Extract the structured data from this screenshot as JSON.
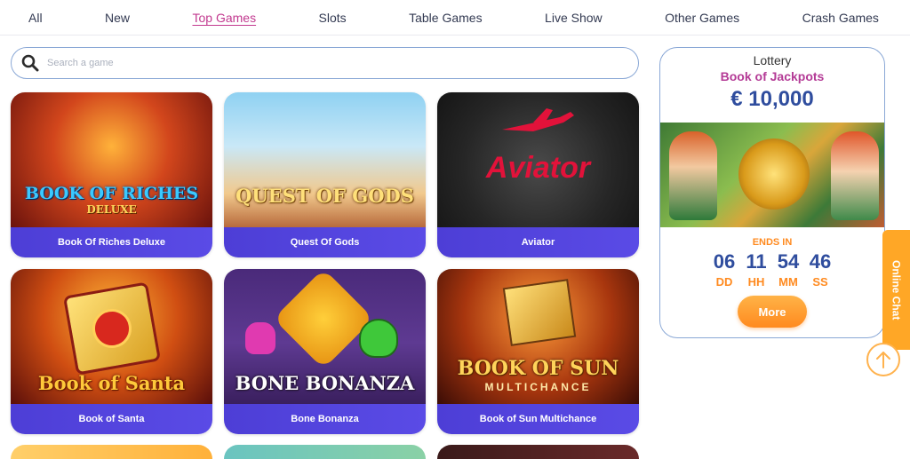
{
  "nav": {
    "tabs": [
      {
        "label": "All"
      },
      {
        "label": "New"
      },
      {
        "label": "Top Games"
      },
      {
        "label": "Slots"
      },
      {
        "label": "Table Games"
      },
      {
        "label": "Live Show"
      },
      {
        "label": "Other Games"
      },
      {
        "label": "Crash Games"
      }
    ],
    "active": "Top Games"
  },
  "search": {
    "placeholder": "Search a game",
    "icon": "search-icon"
  },
  "games": [
    {
      "title": "Book Of Riches Deluxe",
      "art": "BOOK OF RICHES",
      "art_sub": "DELUXE"
    },
    {
      "title": "Quest Of Gods",
      "art": "QUEST OF GODS",
      "art_sub": ""
    },
    {
      "title": "Aviator",
      "art": "Aviator",
      "art_sub": ""
    },
    {
      "title": "Book of Santa",
      "art": "Book of Santa",
      "art_sub": ""
    },
    {
      "title": "Bone Bonanza",
      "art": "BONE BONANZA",
      "art_sub": ""
    },
    {
      "title": "Book of Sun Multichance",
      "art": "BOOK OF SUN",
      "art_sub": "MULTICHANCE"
    }
  ],
  "lottery": {
    "title": "Lottery",
    "name": "Book of Jackpots",
    "amount": "€ 10,000",
    "ends_label": "ENDS IN",
    "timer": [
      {
        "value": "06",
        "unit": "DD"
      },
      {
        "value": "11",
        "unit": "HH"
      },
      {
        "value": "54",
        "unit": "MM"
      },
      {
        "value": "46",
        "unit": "SS"
      }
    ],
    "more_label": "More"
  },
  "chat": {
    "label": "Online Chat"
  },
  "colors": {
    "accent": "#c2398f",
    "card_label": "#4d3ed6",
    "amount": "#2f4d9e",
    "orange": "#ff8a1f"
  }
}
